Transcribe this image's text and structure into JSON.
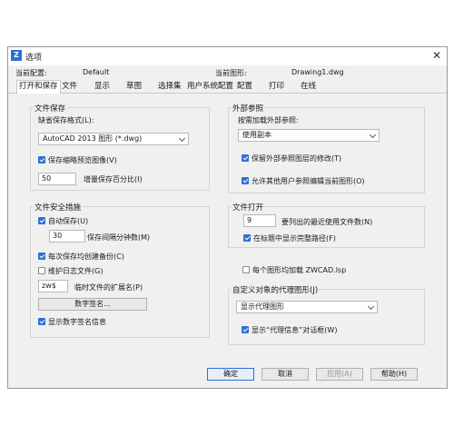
{
  "window": {
    "title": "选项",
    "close_label": "✕"
  },
  "profile": {
    "current_label": "当前配置:",
    "current_value": "Default",
    "drawing_label": "当前图形:",
    "drawing_value": "Drawing1.dwg"
  },
  "tabs": [
    "打开和保存",
    "文件",
    "显示",
    "草图",
    "选择集",
    "用户系统配置",
    "配置",
    "打印",
    "在线"
  ],
  "file_save": {
    "title": "文件保存",
    "format_label": "缺省保存格式(L):",
    "format_value": "AutoCAD 2013 图形 (*.dwg)",
    "thumbnail_label": "保存缩略预览图像(V)",
    "thumbnail_checked": true,
    "incremental_value": "50",
    "incremental_label": "增量保存百分比(I)"
  },
  "file_safety": {
    "title": "文件安全措施",
    "autosave_label": "自动保存(U)",
    "autosave_checked": true,
    "interval_value": "30",
    "interval_label": "保存间隔分钟数(M)",
    "backup_label": "每次保存均创建备份(C)",
    "backup_checked": true,
    "log_label": "维护日志文件(G)",
    "log_checked": false,
    "temp_ext_value": "zw$",
    "temp_ext_label": "临时文件的扩展名(P)",
    "digital_sig_button": "数字签名...",
    "show_sig_label": "显示数字签名信息",
    "show_sig_checked": true
  },
  "xref": {
    "title": "外部参照",
    "load_label": "按需加载外部参照:",
    "load_value": "使用副本",
    "retain_label": "保留外部参照图层的修改(T)",
    "retain_checked": true,
    "allow_label": "允许其他用户参照编辑当前图形(O)",
    "allow_checked": true
  },
  "file_open": {
    "title": "文件打开",
    "recent_value": "9",
    "recent_label": "要列出的最近使用文件数(N)",
    "fullpath_label": "在标题中显示完整路径(F)",
    "fullpath_checked": true
  },
  "load_lsp": {
    "label": "每个图形均加载 ZWCAD.lsp",
    "checked": false
  },
  "proxy": {
    "title": "自定义对象的代理图形(J)",
    "value": "显示代理图形",
    "info_label": "显示“代理信息”对话框(W)",
    "info_checked": true
  },
  "buttons": {
    "ok": "确定",
    "cancel": "取消",
    "apply": "应用(A)",
    "help": "帮助(H)"
  }
}
